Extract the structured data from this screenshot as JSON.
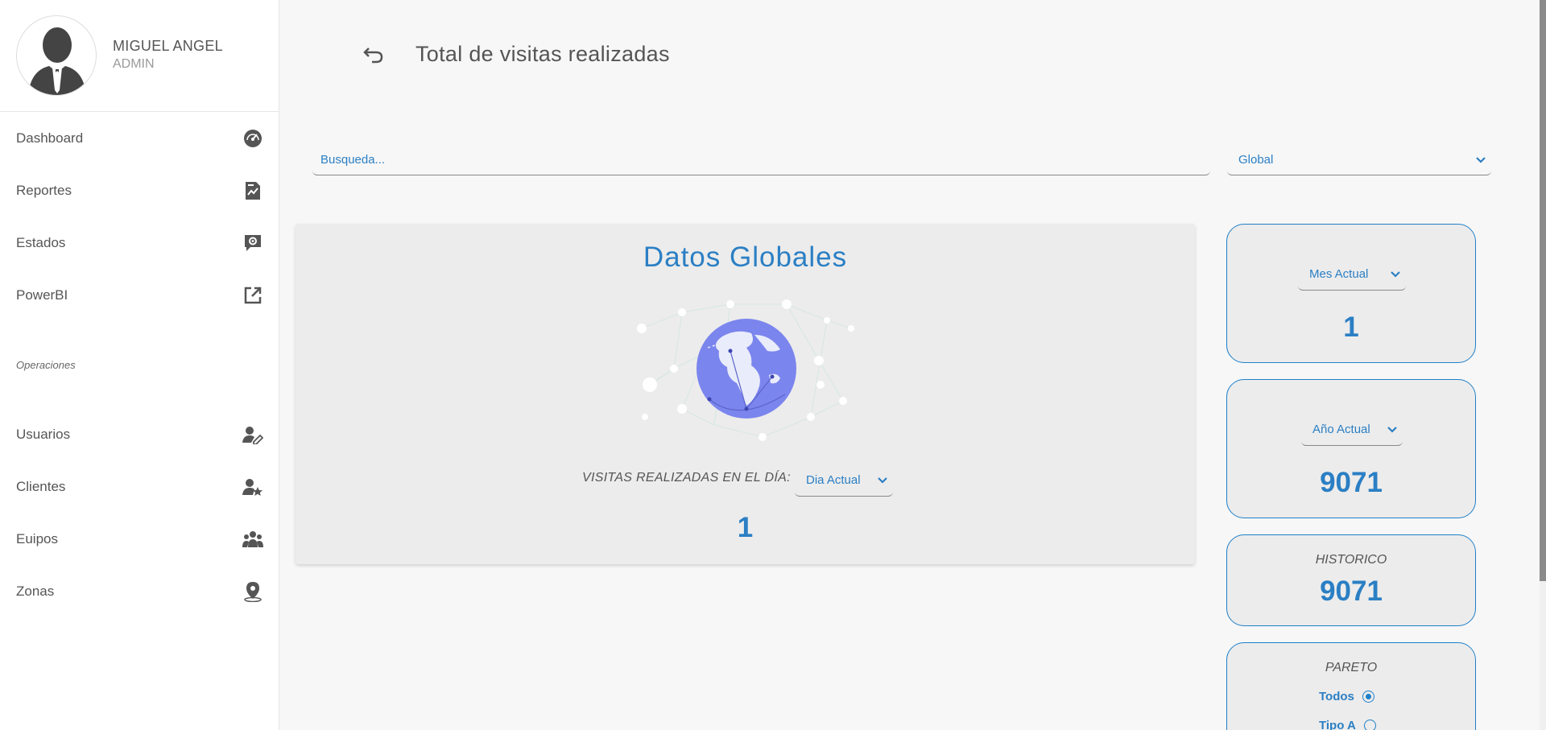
{
  "profile": {
    "name": "MIGUEL ANGEL",
    "role": "ADMIN"
  },
  "nav": {
    "items": [
      {
        "label": "Dashboard",
        "icon": "speedometer-icon"
      },
      {
        "label": "Reportes",
        "icon": "report-chart-icon"
      },
      {
        "label": "Estados",
        "icon": "chat-gear-icon"
      },
      {
        "label": "PowerBI",
        "icon": "external-link-icon"
      }
    ],
    "section_label": "Operaciones",
    "operation_items": [
      {
        "label": "Usuarios",
        "icon": "user-edit-icon"
      },
      {
        "label": "Clientes",
        "icon": "user-star-icon"
      },
      {
        "label": "Euipos",
        "icon": "team-icon"
      },
      {
        "label": "Zonas",
        "icon": "map-pin-icon"
      }
    ]
  },
  "header": {
    "title": "Total de visitas realizadas"
  },
  "filters": {
    "search_placeholder": "Busqueda...",
    "scope_value": "Global"
  },
  "global_card": {
    "title": "Datos Globales",
    "visits_label": "VISITAS REALIZADAS EN EL DÍA:",
    "day_select": "Dia Actual",
    "value": "1"
  },
  "stats": {
    "month": {
      "select": "Mes Actual",
      "value": "1"
    },
    "year": {
      "select": "Año Actual",
      "value": "9071"
    },
    "historic": {
      "label": "HISTORICO",
      "value": "9071"
    },
    "pareto": {
      "label": "PARETO",
      "option_all": "Todos",
      "option_partial": "Tipo A"
    }
  },
  "colors": {
    "accent": "#2b7fc4",
    "border": "#1f80c9",
    "globe": "#7b85ee"
  }
}
